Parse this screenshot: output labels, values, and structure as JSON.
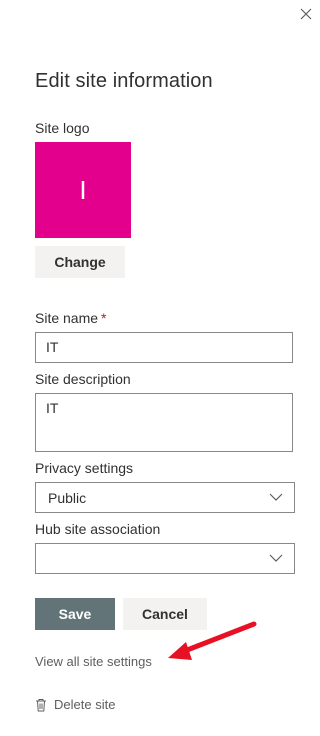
{
  "panel": {
    "title": "Edit site information",
    "close_icon": "close-icon"
  },
  "logo": {
    "label": "Site logo",
    "letter": "I",
    "color": "#e3008c",
    "change_label": "Change"
  },
  "form": {
    "site_name_label": "Site name",
    "required_marker": "*",
    "site_name_value": "IT",
    "site_description_label": "Site description",
    "site_description_value": "IT",
    "privacy_label": "Privacy settings",
    "privacy_value": "Public",
    "hub_label": "Hub site association",
    "hub_value": ""
  },
  "actions": {
    "save_label": "Save",
    "cancel_label": "Cancel",
    "save_color": "#637478"
  },
  "links": {
    "view_all_settings": "View all site settings",
    "delete_site": "Delete site"
  },
  "annotation": {
    "arrow_color": "#e81123"
  }
}
